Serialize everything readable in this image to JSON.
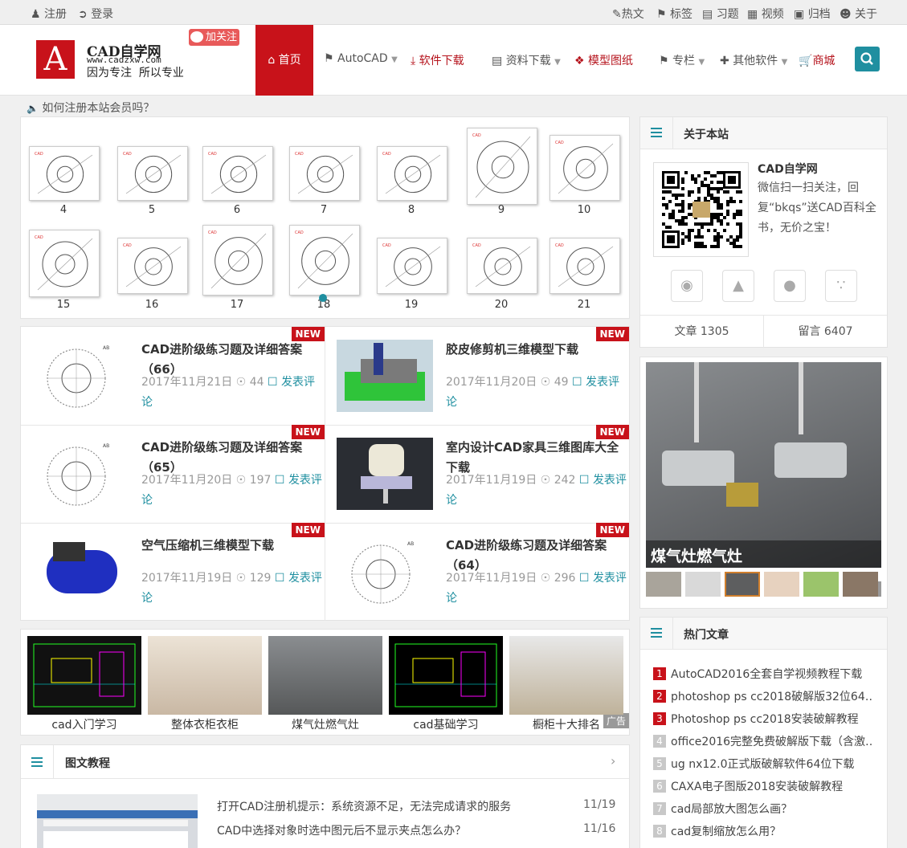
{
  "topbar": {
    "register": "注册",
    "login": "登录",
    "links": [
      "热文",
      "标签",
      "习题",
      "视频",
      "归档",
      "关于"
    ]
  },
  "header": {
    "logo_letter": "A",
    "site_name": "CAD自学网",
    "site_url": "www.cadzxw.com",
    "slogan": "因为专注  所以专业",
    "follow": "加关注",
    "nav": {
      "home": "首页",
      "autocad": "AutoCAD",
      "software": "软件下载",
      "resources": "资料下载",
      "models": "模型图纸",
      "column": "专栏",
      "other": "其他软件",
      "shop": "商城"
    }
  },
  "notice": "如何注册本站会员吗？",
  "gallery": {
    "row1": [
      "4",
      "5",
      "6",
      "7",
      "8",
      "9",
      "10"
    ],
    "row2": [
      "15",
      "16",
      "17",
      "18",
      "19",
      "20",
      "21"
    ]
  },
  "articles": [
    {
      "title": "CAD进阶级练习题及详细答案（66）",
      "date": "2017年11月21日",
      "views": "44",
      "comment": "发表评论",
      "badge": "NEW"
    },
    {
      "title": "胶皮修剪机三维模型下载",
      "date": "2017年11月20日",
      "views": "49",
      "comment": "发表评论",
      "badge": "NEW"
    },
    {
      "title": "CAD进阶级练习题及详细答案（65）",
      "date": "2017年11月20日",
      "views": "197",
      "comment": "发表评论",
      "badge": "NEW"
    },
    {
      "title": "室内设计CAD家具三维图库大全下载",
      "date": "2017年11月19日",
      "views": "242",
      "comment": "发表评论",
      "badge": "NEW"
    },
    {
      "title": "空气压缩机三维模型下载",
      "date": "2017年11月19日",
      "views": "129",
      "comment": "发表评论",
      "badge": "NEW"
    },
    {
      "title": "CAD进阶级练习题及详细答案（64）",
      "date": "2017年11月19日",
      "views": "296",
      "comment": "发表评论",
      "badge": "NEW"
    }
  ],
  "strip": {
    "captions": [
      "cad入门学习",
      "整体衣柜衣柜",
      "煤气灶燃气灶",
      "cad基础学习",
      "橱柜十大排名"
    ],
    "ad": "广告"
  },
  "tutorials": {
    "title": "图文教程",
    "items": [
      {
        "text": "打开CAD注册机提示：系统资源不足，无法完成请求的服务",
        "date": "11/19"
      },
      {
        "text": "CAD中选择对象时选中图元后不显示夹点怎么办？",
        "date": "11/16"
      }
    ]
  },
  "about": {
    "title": "关于本站",
    "name": "CAD自学网",
    "desc": "微信扫一扫关注，回复“bkqs”送CAD百科全书，无价之宝！",
    "articles": "文章 1305",
    "comments": "留言 6407"
  },
  "ad_block": {
    "caption": "煤气灶燃气灶",
    "ad": "广告"
  },
  "hot": {
    "title": "热门文章",
    "items": [
      "AutoCAD2016全套自学视频教程下载",
      "photoshop ps cc2018破解版32位64…",
      "Photoshop ps cc2018安装破解教程",
      "office2016完整免费破解版下载（含激…",
      "ug nx12.0正式版破解软件64位下载",
      "CAXA电子图版2018安装破解教程",
      "cad局部放大图怎么画？",
      "cad复制缩放怎么用？"
    ],
    "numbers": [
      "1",
      "2",
      "3",
      "4",
      "5",
      "6",
      "7",
      "8"
    ]
  },
  "colors": {
    "brand_red": "#c8121a",
    "accent_teal": "#1f8fa0",
    "hot_red": "#c8121a",
    "hot_grey": "#c8c8c8"
  }
}
